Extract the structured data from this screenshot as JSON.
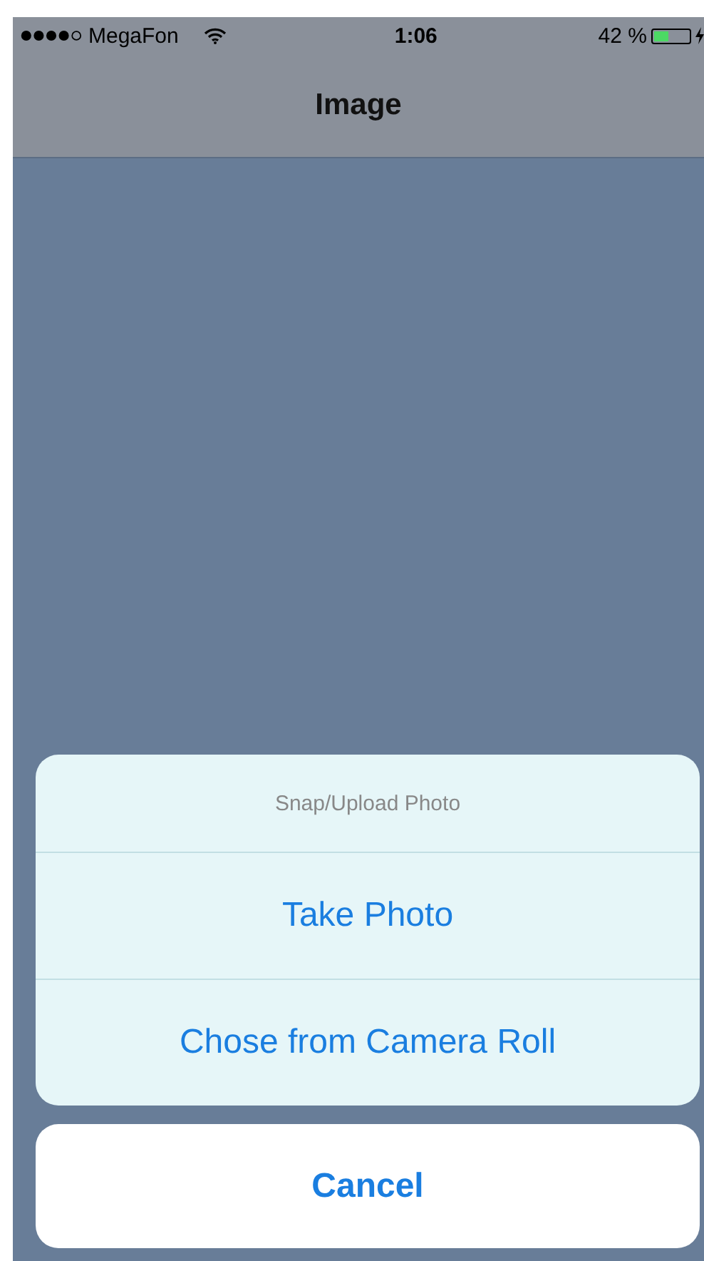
{
  "status_bar": {
    "carrier": "MegaFon",
    "time": "1:06",
    "battery_percent": "42 %",
    "battery": {
      "level": 0.42
    }
  },
  "nav_bar": {
    "title": "Image"
  },
  "action_sheet": {
    "title": "Snap/Upload Photo",
    "actions": [
      {
        "label": "Take Photo"
      },
      {
        "label": "Chose from Camera Roll"
      }
    ],
    "cancel": "Cancel"
  }
}
